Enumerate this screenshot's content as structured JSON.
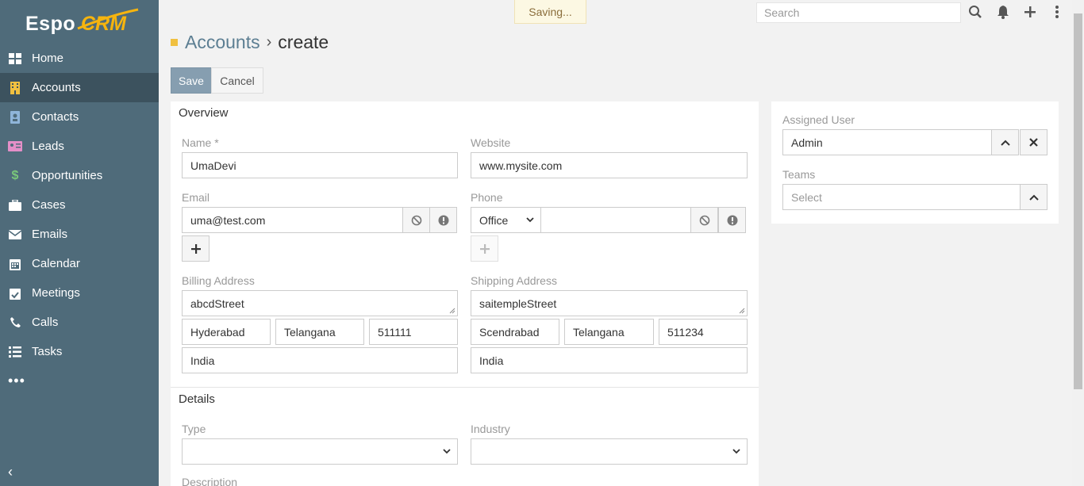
{
  "app": {
    "logo_primary": "Espo",
    "logo_secondary": "CRM"
  },
  "topbar": {
    "saving_text": "Saving...",
    "search_placeholder": "Search",
    "icons": [
      "search-icon",
      "bell-icon",
      "plus-icon",
      "kebab-menu-icon"
    ]
  },
  "sidebar": {
    "items": [
      {
        "label": "Home",
        "icon": "dashboard-grid-icon",
        "color": "#ffffff"
      },
      {
        "label": "Accounts",
        "icon": "building-icon",
        "color": "#f0c040",
        "active": true
      },
      {
        "label": "Contacts",
        "icon": "contact-card-icon",
        "color": "#8fb5d9"
      },
      {
        "label": "Leads",
        "icon": "id-card-icon",
        "color": "#e48fc8"
      },
      {
        "label": "Opportunities",
        "icon": "dollar-icon",
        "color": "#7ac77a"
      },
      {
        "label": "Cases",
        "icon": "briefcase-icon",
        "color": "#ffffff"
      },
      {
        "label": "Emails",
        "icon": "envelope-icon",
        "color": "#ffffff"
      },
      {
        "label": "Calendar",
        "icon": "calendar-icon",
        "color": "#ffffff"
      },
      {
        "label": "Meetings",
        "icon": "calendar-check-icon",
        "color": "#ffffff"
      },
      {
        "label": "Calls",
        "icon": "phone-icon",
        "color": "#ffffff"
      },
      {
        "label": "Tasks",
        "icon": "task-list-icon",
        "color": "#ffffff"
      }
    ],
    "more": "•••",
    "collapse": "‹"
  },
  "header": {
    "breadcrumb": "Accounts",
    "separator": "›",
    "title": "create"
  },
  "actions": {
    "save": "Save",
    "cancel": "Cancel"
  },
  "overview": {
    "title": "Overview",
    "name_label": "Name *",
    "name_value": "UmaDevi",
    "website_label": "Website",
    "website_value": "www.mysite.com",
    "email_label": "Email",
    "email_value": "uma@test.com",
    "phone_label": "Phone",
    "phone_type": "Office",
    "phone_value": "",
    "billing_label": "Billing Address",
    "billing": {
      "street": "abcdStreet",
      "city": "Hyderabad",
      "state": "Telangana",
      "postal": "511111",
      "country": "India"
    },
    "shipping_label": "Shipping Address",
    "shipping": {
      "street": "saitempleStreet",
      "city": "Scendrabad",
      "state": "Telangana",
      "postal": "511234",
      "country": "India"
    }
  },
  "details": {
    "title": "Details",
    "type_label": "Type",
    "type_value": "",
    "industry_label": "Industry",
    "industry_value": "",
    "description_label": "Description"
  },
  "side": {
    "assigned_label": "Assigned User",
    "assigned_value": "Admin",
    "teams_label": "Teams",
    "teams_placeholder": "Select"
  },
  "colors": {
    "sidebar": "#4f6b7a",
    "accent": "#869eb0",
    "link": "#5c7e92"
  }
}
